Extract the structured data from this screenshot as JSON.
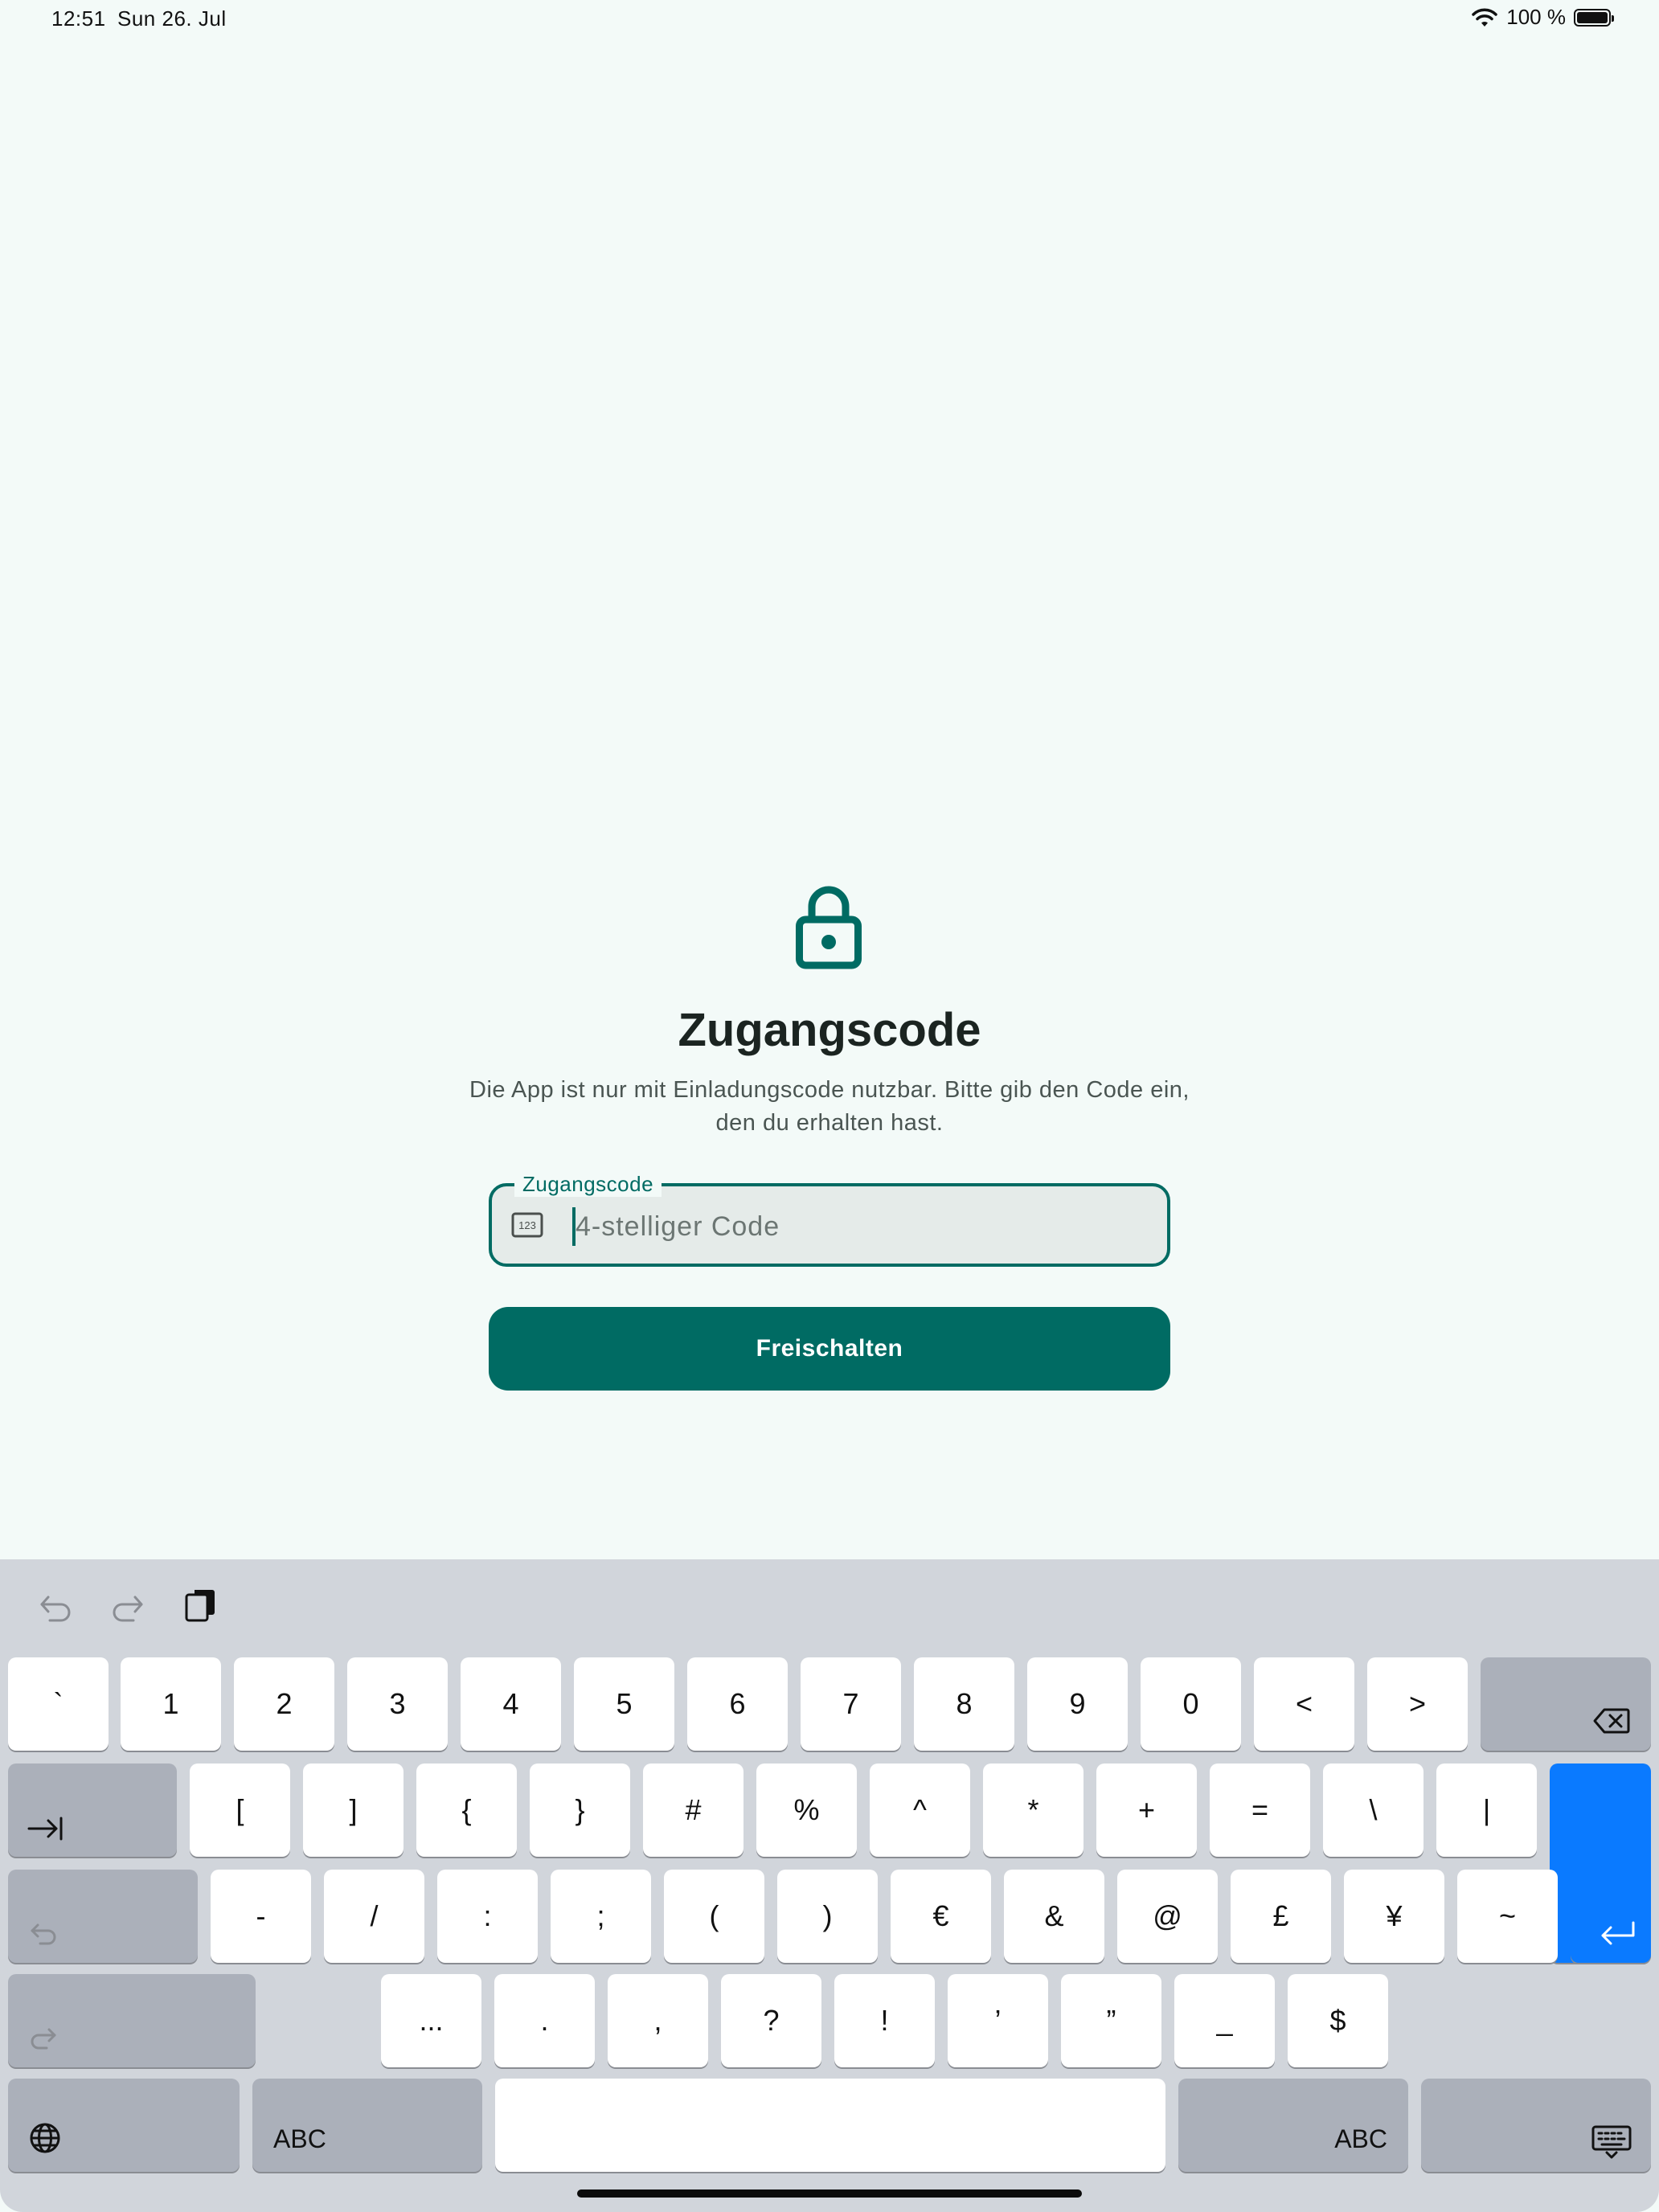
{
  "status_bar": {
    "time": "12:51",
    "date": "Sun 26. Jul",
    "battery": "100 %"
  },
  "content": {
    "icon": "lock-icon",
    "title": "Zugangscode",
    "description": "Die App ist nur mit Einladungscode nutzbar. Bitte gib den Code ein, den du erhalten hast.",
    "field_label": "Zugangscode",
    "field_placeholder": "4-stelliger Code",
    "field_value": "",
    "unlock_button": "Freischalten"
  },
  "colors": {
    "accent": "#006b63",
    "background": "#f3faf8",
    "keyboard": "#d1d5db",
    "return_key": "#0a7aff"
  },
  "keyboard": {
    "row1": [
      "`",
      "1",
      "2",
      "3",
      "4",
      "5",
      "6",
      "7",
      "8",
      "9",
      "0",
      "<",
      ">"
    ],
    "row2": [
      "[",
      "]",
      "{",
      "}",
      "#",
      "%",
      "^",
      "*",
      "+",
      "=",
      "\\",
      "|"
    ],
    "row3": [
      "-",
      "/",
      ":",
      ";",
      "(",
      ")",
      "€",
      "&",
      "@",
      "£",
      "¥",
      "~"
    ],
    "row4": [
      "...",
      ".",
      ",",
      "?",
      "!",
      "’",
      "”",
      "_",
      "$"
    ],
    "abc_left": "ABC",
    "abc_right": "ABC"
  }
}
